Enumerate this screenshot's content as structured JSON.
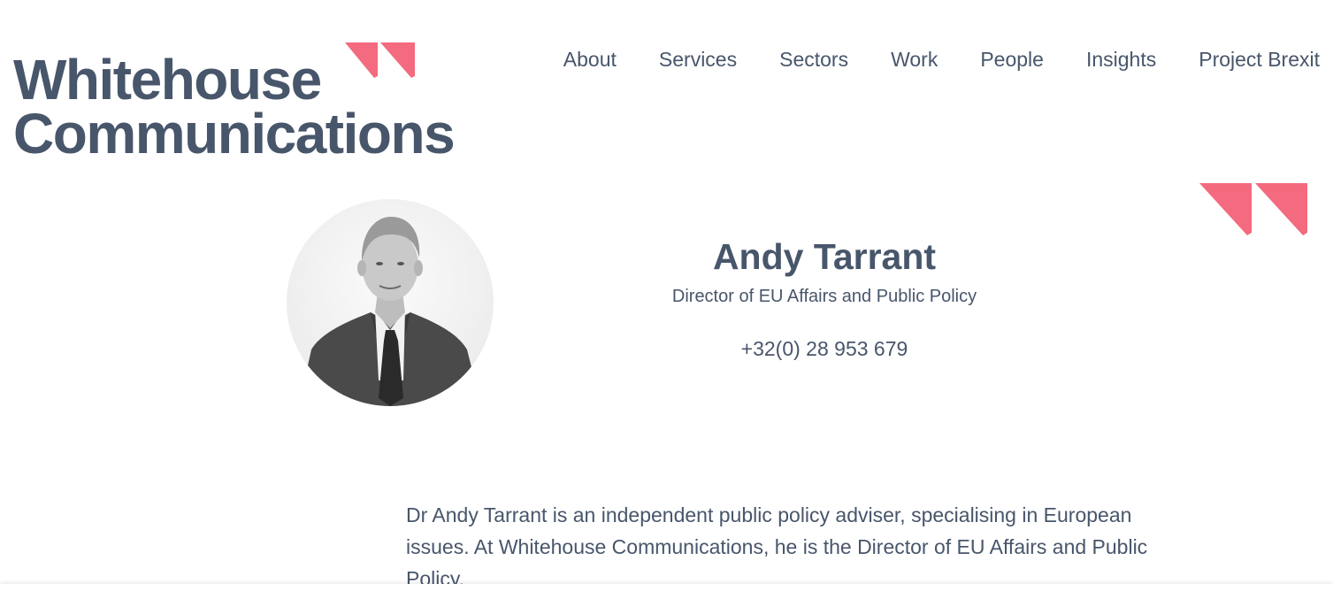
{
  "brand": {
    "line1": "Whitehouse",
    "line2": "Communications",
    "text_color": "#48566b",
    "accent_color": "#f46a7e"
  },
  "nav": {
    "items": [
      {
        "label": "About"
      },
      {
        "label": "Services"
      },
      {
        "label": "Sectors"
      },
      {
        "label": "Work"
      },
      {
        "label": "People"
      },
      {
        "label": "Insights"
      },
      {
        "label": "Project Brexit"
      }
    ]
  },
  "profile": {
    "name": "Andy Tarrant",
    "role": "Director of EU Affairs and Public Policy",
    "phone": "+32(0) 28 953 679",
    "photo_icon": "portrait-photo"
  },
  "bio": {
    "text": "Dr Andy Tarrant is an independent public policy adviser, specialising in European issues. At Whitehouse Communications, he is the Director of EU Affairs and Public Policy."
  },
  "decor": {
    "quote_icon": "quote-marks-icon"
  }
}
